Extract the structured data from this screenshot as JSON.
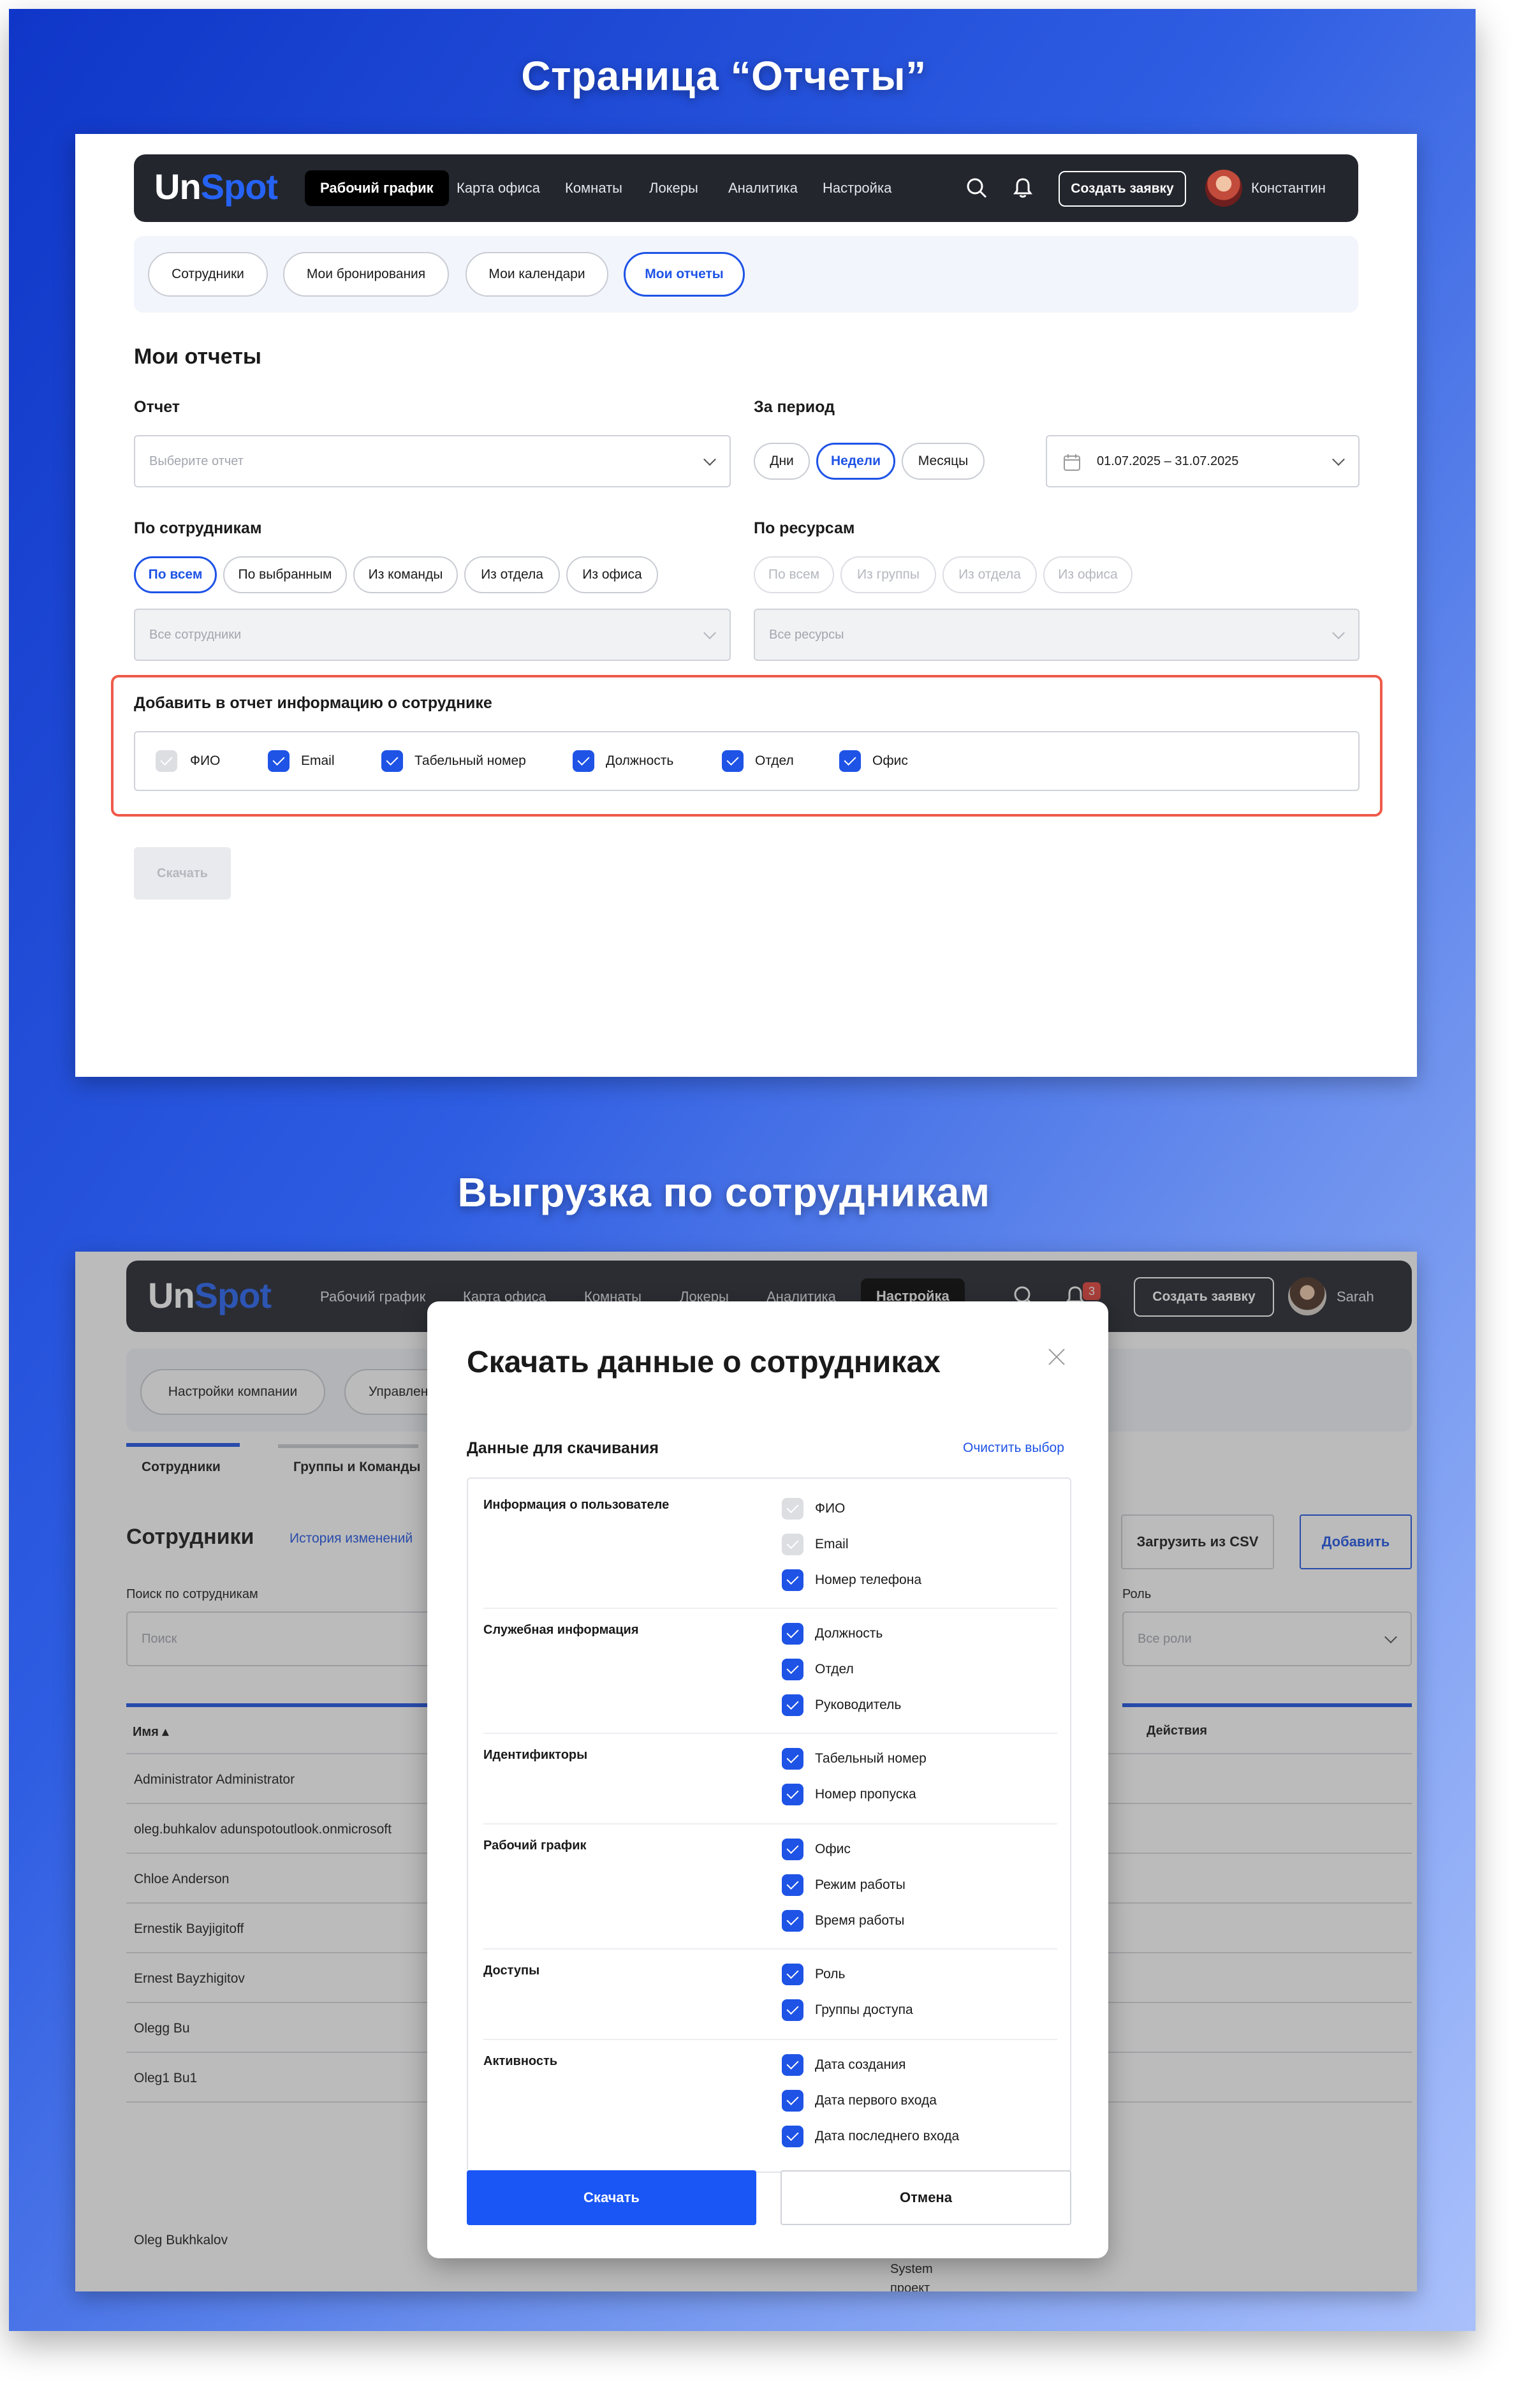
{
  "section1": {
    "title": "Страница “Отчеты”",
    "nav": {
      "logo_a": "Un",
      "logo_b": "Spot",
      "items": [
        "Рабочий график",
        "Карта офиса",
        "Комнаты",
        "Локеры",
        "Аналитика",
        "Настройка"
      ],
      "create_button": "Создать заявку",
      "user": "Константин"
    },
    "tabs": [
      "Сотрудники",
      "Мои бронирования",
      "Мои календари",
      "Мои отчеты"
    ],
    "heading": "Мои отчеты",
    "report": {
      "label": "Отчет",
      "placeholder": "Выберите отчет"
    },
    "period": {
      "label": "За период",
      "options": [
        "Дни",
        "Недели",
        "Месяцы"
      ],
      "selected": "Недели",
      "date_range": "01.07.2025 – 31.07.2025"
    },
    "by_employees": {
      "label": "По сотрудникам",
      "options": [
        "По всем",
        "По выбранным",
        "Из команды",
        "Из отдела",
        "Из офиса"
      ],
      "selected": "По всем",
      "select_value": "Все сотрудники"
    },
    "by_resources": {
      "label": "По ресурсам",
      "options": [
        "По всем",
        "Из группы",
        "Из отдела",
        "Из офиса"
      ],
      "select_value": "Все ресурсы"
    },
    "add_info": {
      "label": "Добавить в отчет информацию о сотруднике",
      "fields": [
        "ФИО",
        "Email",
        "Табельный номер",
        "Должность",
        "Отдел",
        "Офис"
      ]
    },
    "download_button": "Скачать"
  },
  "section2": {
    "title": "Выгрузка по сотрудникам",
    "nav": {
      "logo_a": "Un",
      "logo_b": "Spot",
      "items": [
        "Рабочий график",
        "Карта офиса",
        "Комнаты",
        "Локеры",
        "Аналитика",
        "Настройка"
      ],
      "create_button": "Создать заявку",
      "user": "Sarah",
      "badge": "3"
    },
    "tabs": [
      "Настройки компании",
      "Управлен"
    ],
    "subtabs": [
      "Сотрудники",
      "Группы и Команды"
    ],
    "heading": "Сотрудники",
    "history_link": "История изменений",
    "upload_csv": "Загрузить из CSV",
    "add_button": "Добавить",
    "search_label": "Поиск по сотрудникам",
    "search_placeholder": "Поиск",
    "role_label": "Роль",
    "role_value": "Все роли",
    "col_name": "Имя ▴",
    "col_actions": "Действия",
    "rows": [
      "Administrator Administrator",
      "oleg.buhkalov adunspotoutlook.onmicrosoft",
      "Chloe Anderson",
      "Ernestik Bayjigitoff",
      "Ernest Bayzhigitov",
      "Olegg Bu",
      "Oleg1 Bu1",
      "Oleg Bukhkalov"
    ],
    "bottom_text": [
      "System",
      "проект"
    ],
    "modal": {
      "title": "Скачать данные о сотрудниках",
      "subtitle": "Данные для скачивания",
      "clear_link": "Очистить выбор",
      "groups": [
        {
          "title": "Информация о пользователе",
          "items": [
            {
              "label": "ФИО",
              "disabled": true
            },
            {
              "label": "Email",
              "disabled": true
            },
            {
              "label": "Номер телефона",
              "disabled": false
            }
          ]
        },
        {
          "title": "Служебная информация",
          "items": [
            {
              "label": "Должность",
              "disabled": false
            },
            {
              "label": "Отдел",
              "disabled": false
            },
            {
              "label": "Руководитель",
              "disabled": false
            }
          ]
        },
        {
          "title": "Идентификторы",
          "items": [
            {
              "label": "Табельный номер",
              "disabled": false
            },
            {
              "label": "Номер пропуска",
              "disabled": false
            }
          ]
        },
        {
          "title": "Рабочий график",
          "items": [
            {
              "label": "Офис",
              "disabled": false
            },
            {
              "label": "Режим работы",
              "disabled": false
            },
            {
              "label": "Время работы",
              "disabled": false
            }
          ]
        },
        {
          "title": "Доступы",
          "items": [
            {
              "label": "Роль",
              "disabled": false
            },
            {
              "label": "Группы доступа",
              "disabled": false
            }
          ]
        },
        {
          "title": "Активность",
          "items": [
            {
              "label": "Дата создания",
              "disabled": false
            },
            {
              "label": "Дата первого входа",
              "disabled": false
            },
            {
              "label": "Дата последнего входа",
              "disabled": false
            }
          ]
        }
      ],
      "download_button": "Скачать",
      "cancel_button": "Отмена"
    }
  }
}
